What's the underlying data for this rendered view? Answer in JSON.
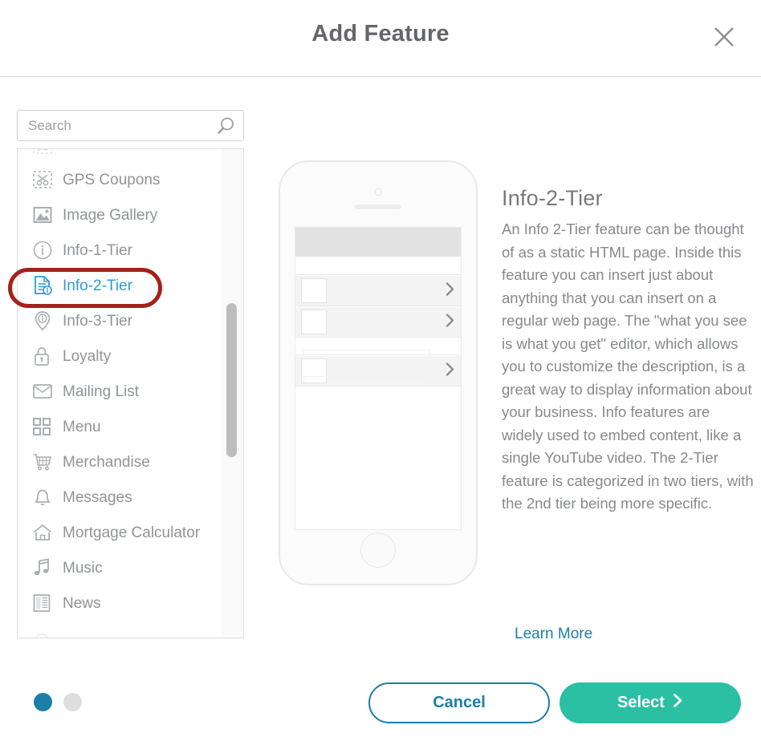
{
  "header": {
    "title": "Add Feature",
    "close_icon": "close-icon"
  },
  "search": {
    "placeholder": "Search",
    "value": "",
    "icon": "search-icon"
  },
  "feature_list": {
    "scrollbar": "vertical-scrollbar",
    "items": [
      {
        "label": "",
        "icon": "scissors-icon",
        "clipped": "top",
        "selected": false
      },
      {
        "label": "GPS Coupons",
        "icon": "gps-coupons-icon",
        "selected": false
      },
      {
        "label": "Image Gallery",
        "icon": "image-gallery-icon",
        "selected": false
      },
      {
        "label": "Info-1-Tier",
        "icon": "info-circle-icon",
        "selected": false
      },
      {
        "label": "Info-2-Tier",
        "icon": "document-info-icon",
        "selected": true
      },
      {
        "label": "Info-3-Tier",
        "icon": "map-pin-icon",
        "selected": false
      },
      {
        "label": "Loyalty",
        "icon": "lock-icon",
        "selected": false
      },
      {
        "label": "Mailing List",
        "icon": "envelope-icon",
        "selected": false
      },
      {
        "label": "Menu",
        "icon": "grid-icon",
        "selected": false
      },
      {
        "label": "Merchandise",
        "icon": "shopping-cart-icon",
        "selected": false
      },
      {
        "label": "Messages",
        "icon": "bell-icon",
        "selected": false
      },
      {
        "label": "Mortgage Calculator",
        "icon": "house-icon",
        "selected": false
      },
      {
        "label": "Music",
        "icon": "music-note-icon",
        "selected": false
      },
      {
        "label": "News",
        "icon": "newspaper-icon",
        "selected": false
      },
      {
        "label": "",
        "icon": "partial-icon",
        "clipped": "bottom",
        "selected": false
      }
    ]
  },
  "annotation": {
    "shape": "oval-highlight",
    "target": "Info-2-Tier",
    "color": "#a5211b"
  },
  "preview": {
    "device": "phone-mockup",
    "rows": 3,
    "chevron": "chevron-right-icon"
  },
  "detail": {
    "title": "Info-2-Tier",
    "description": "An Info 2-Tier feature can be thought of as a static HTML page. Inside this feature you can insert just about anything that you can insert on a regular web page. The \"what you see is what you get\" editor, which allows you to customize the description, is a great way to display information about your business. Info features are widely used to embed content, like a single YouTube video. The 2-Tier feature is categorized in two tiers, with the 2nd tier being more specific.",
    "learn_more": "Learn More"
  },
  "footer": {
    "pagination": {
      "total": 2,
      "active_index": 0
    },
    "cancel_label": "Cancel",
    "select_label": "Select",
    "select_chevron": "chevron-right-icon"
  },
  "colors": {
    "accent_blue": "#1b7fa8",
    "selected_blue": "#2e9bd6",
    "select_green": "#2bbfa4",
    "annotation_red": "#a5211b",
    "text_gray": "#86898d"
  }
}
